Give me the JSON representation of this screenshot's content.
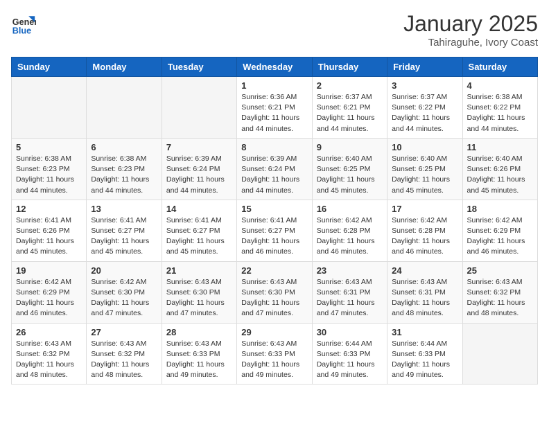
{
  "logo": {
    "general": "General",
    "blue": "Blue"
  },
  "title": "January 2025",
  "subtitle": "Tahiraguhe, Ivory Coast",
  "days": [
    "Sunday",
    "Monday",
    "Tuesday",
    "Wednesday",
    "Thursday",
    "Friday",
    "Saturday"
  ],
  "weeks": [
    [
      {
        "day": "",
        "content": ""
      },
      {
        "day": "",
        "content": ""
      },
      {
        "day": "",
        "content": ""
      },
      {
        "day": "1",
        "content": "Sunrise: 6:36 AM\nSunset: 6:21 PM\nDaylight: 11 hours and 44 minutes."
      },
      {
        "day": "2",
        "content": "Sunrise: 6:37 AM\nSunset: 6:21 PM\nDaylight: 11 hours and 44 minutes."
      },
      {
        "day": "3",
        "content": "Sunrise: 6:37 AM\nSunset: 6:22 PM\nDaylight: 11 hours and 44 minutes."
      },
      {
        "day": "4",
        "content": "Sunrise: 6:38 AM\nSunset: 6:22 PM\nDaylight: 11 hours and 44 minutes."
      }
    ],
    [
      {
        "day": "5",
        "content": "Sunrise: 6:38 AM\nSunset: 6:23 PM\nDaylight: 11 hours and 44 minutes."
      },
      {
        "day": "6",
        "content": "Sunrise: 6:38 AM\nSunset: 6:23 PM\nDaylight: 11 hours and 44 minutes."
      },
      {
        "day": "7",
        "content": "Sunrise: 6:39 AM\nSunset: 6:24 PM\nDaylight: 11 hours and 44 minutes."
      },
      {
        "day": "8",
        "content": "Sunrise: 6:39 AM\nSunset: 6:24 PM\nDaylight: 11 hours and 44 minutes."
      },
      {
        "day": "9",
        "content": "Sunrise: 6:40 AM\nSunset: 6:25 PM\nDaylight: 11 hours and 45 minutes."
      },
      {
        "day": "10",
        "content": "Sunrise: 6:40 AM\nSunset: 6:25 PM\nDaylight: 11 hours and 45 minutes."
      },
      {
        "day": "11",
        "content": "Sunrise: 6:40 AM\nSunset: 6:26 PM\nDaylight: 11 hours and 45 minutes."
      }
    ],
    [
      {
        "day": "12",
        "content": "Sunrise: 6:41 AM\nSunset: 6:26 PM\nDaylight: 11 hours and 45 minutes."
      },
      {
        "day": "13",
        "content": "Sunrise: 6:41 AM\nSunset: 6:27 PM\nDaylight: 11 hours and 45 minutes."
      },
      {
        "day": "14",
        "content": "Sunrise: 6:41 AM\nSunset: 6:27 PM\nDaylight: 11 hours and 45 minutes."
      },
      {
        "day": "15",
        "content": "Sunrise: 6:41 AM\nSunset: 6:27 PM\nDaylight: 11 hours and 46 minutes."
      },
      {
        "day": "16",
        "content": "Sunrise: 6:42 AM\nSunset: 6:28 PM\nDaylight: 11 hours and 46 minutes."
      },
      {
        "day": "17",
        "content": "Sunrise: 6:42 AM\nSunset: 6:28 PM\nDaylight: 11 hours and 46 minutes."
      },
      {
        "day": "18",
        "content": "Sunrise: 6:42 AM\nSunset: 6:29 PM\nDaylight: 11 hours and 46 minutes."
      }
    ],
    [
      {
        "day": "19",
        "content": "Sunrise: 6:42 AM\nSunset: 6:29 PM\nDaylight: 11 hours and 46 minutes."
      },
      {
        "day": "20",
        "content": "Sunrise: 6:42 AM\nSunset: 6:30 PM\nDaylight: 11 hours and 47 minutes."
      },
      {
        "day": "21",
        "content": "Sunrise: 6:43 AM\nSunset: 6:30 PM\nDaylight: 11 hours and 47 minutes."
      },
      {
        "day": "22",
        "content": "Sunrise: 6:43 AM\nSunset: 6:30 PM\nDaylight: 11 hours and 47 minutes."
      },
      {
        "day": "23",
        "content": "Sunrise: 6:43 AM\nSunset: 6:31 PM\nDaylight: 11 hours and 47 minutes."
      },
      {
        "day": "24",
        "content": "Sunrise: 6:43 AM\nSunset: 6:31 PM\nDaylight: 11 hours and 48 minutes."
      },
      {
        "day": "25",
        "content": "Sunrise: 6:43 AM\nSunset: 6:32 PM\nDaylight: 11 hours and 48 minutes."
      }
    ],
    [
      {
        "day": "26",
        "content": "Sunrise: 6:43 AM\nSunset: 6:32 PM\nDaylight: 11 hours and 48 minutes."
      },
      {
        "day": "27",
        "content": "Sunrise: 6:43 AM\nSunset: 6:32 PM\nDaylight: 11 hours and 48 minutes."
      },
      {
        "day": "28",
        "content": "Sunrise: 6:43 AM\nSunset: 6:33 PM\nDaylight: 11 hours and 49 minutes."
      },
      {
        "day": "29",
        "content": "Sunrise: 6:43 AM\nSunset: 6:33 PM\nDaylight: 11 hours and 49 minutes."
      },
      {
        "day": "30",
        "content": "Sunrise: 6:44 AM\nSunset: 6:33 PM\nDaylight: 11 hours and 49 minutes."
      },
      {
        "day": "31",
        "content": "Sunrise: 6:44 AM\nSunset: 6:33 PM\nDaylight: 11 hours and 49 minutes."
      },
      {
        "day": "",
        "content": ""
      }
    ]
  ]
}
